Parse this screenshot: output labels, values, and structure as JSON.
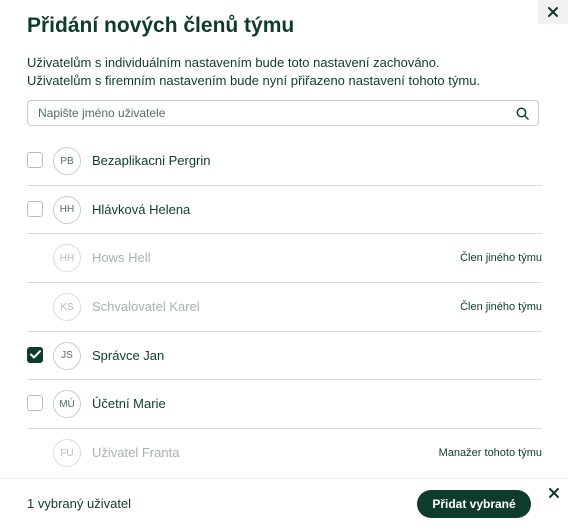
{
  "dialog": {
    "title": "Přidání nových členů týmu",
    "description_line1": "Uživatelům s individuálním nastavením bude toto nastavení zachováno.",
    "description_line2": "Uživatelům s firemním nastavením bude nyní přiřazeno nastavení tohoto týmu."
  },
  "search": {
    "placeholder": "Napište jméno uživatele",
    "value": ""
  },
  "users": [
    {
      "initials": "PB",
      "name": "Bezaplikacni Pergrin",
      "checked": false,
      "disabled": false,
      "note": ""
    },
    {
      "initials": "HH",
      "name": "Hlávková Helena",
      "checked": false,
      "disabled": false,
      "note": ""
    },
    {
      "initials": "HH",
      "name": "Hows Hell",
      "checked": false,
      "disabled": true,
      "note": "Člen jiného týmu"
    },
    {
      "initials": "KS",
      "name": "Schvalovatel Karel",
      "checked": false,
      "disabled": true,
      "note": "Člen jiného týmu"
    },
    {
      "initials": "JS",
      "name": "Správce Jan",
      "checked": true,
      "disabled": false,
      "note": ""
    },
    {
      "initials": "MÚ",
      "name": "Účetní Marie",
      "checked": false,
      "disabled": false,
      "note": ""
    },
    {
      "initials": "FU",
      "name": "Uživatel Franta",
      "checked": false,
      "disabled": true,
      "note": "Manažer tohoto týmu"
    }
  ],
  "footer": {
    "selected_count_text": "1 vybraný uživatel",
    "add_button_label": "Přidat vybrané"
  },
  "icons": {
    "close": "close-icon",
    "search": "search-icon",
    "check": "check-icon"
  },
  "colors": {
    "primary": "#0f3b2c",
    "disabled_text": "#a9b0ad"
  }
}
